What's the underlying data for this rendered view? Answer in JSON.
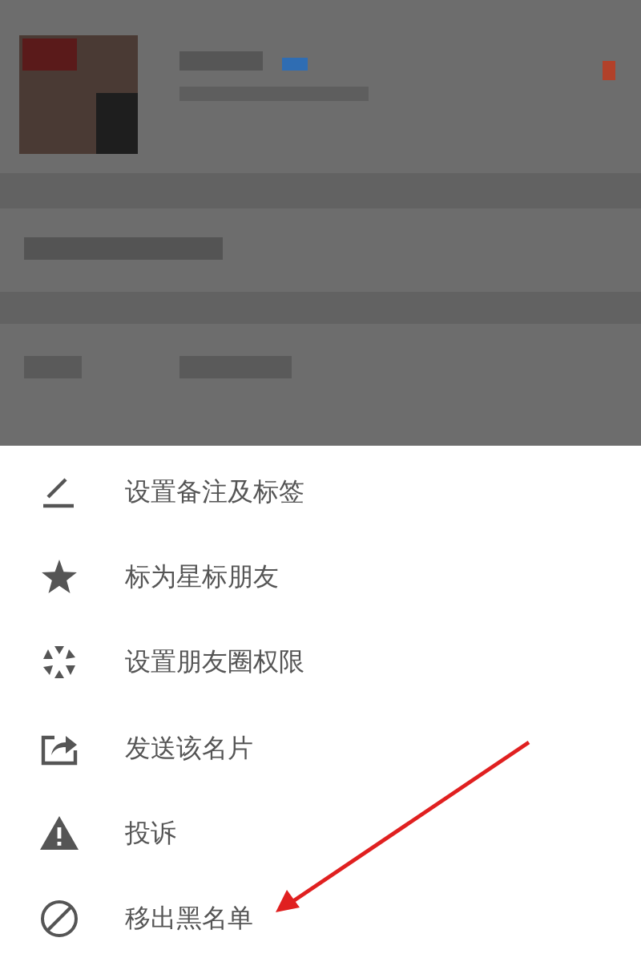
{
  "menu": {
    "items": [
      {
        "label": "设置备注及标签",
        "kind": "edit"
      },
      {
        "label": "标为星标朋友",
        "kind": "star"
      },
      {
        "label": "设置朋友圈权限",
        "kind": "aperture"
      },
      {
        "label": "发送该名片",
        "kind": "share"
      },
      {
        "label": "投诉",
        "kind": "warning"
      },
      {
        "label": "移出黑名单",
        "kind": "block"
      }
    ]
  }
}
